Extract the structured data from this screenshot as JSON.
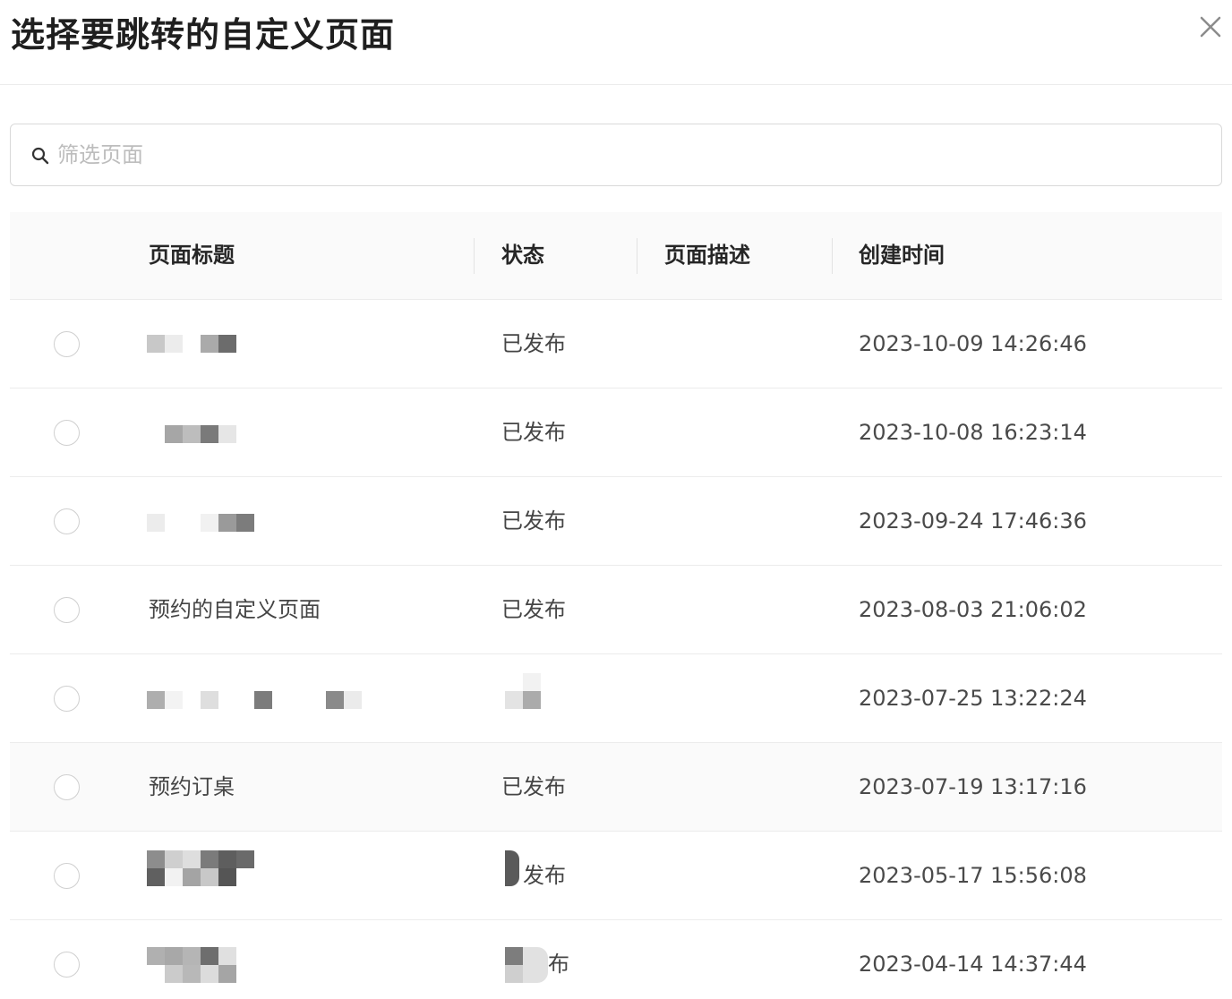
{
  "dialog": {
    "title": "选择要跳转的自定义页面"
  },
  "search": {
    "placeholder": "筛选页面",
    "value": ""
  },
  "table": {
    "columns": [
      "页面标题",
      "状态",
      "页面描述",
      "创建时间"
    ],
    "rows": [
      {
        "title": "",
        "status": "已发布",
        "description": "",
        "created": "2023-10-09 14:26:46"
      },
      {
        "title": "",
        "status": "已发布",
        "description": "",
        "created": "2023-10-08 16:23:14"
      },
      {
        "title": "",
        "status": "已发布",
        "description": "",
        "created": "2023-09-24 17:46:36"
      },
      {
        "title": "预约的自定义页面",
        "status": "已发布",
        "description": "",
        "created": "2023-08-03 21:06:02"
      },
      {
        "title": "",
        "status": "",
        "description": "",
        "created": "2023-07-25 13:22:24"
      },
      {
        "title": "预约订桌",
        "status": "已发布",
        "description": "",
        "created": "2023-07-19 13:17:16"
      },
      {
        "title": "",
        "status": "发布",
        "description": "",
        "created": "2023-05-17 15:56:08"
      },
      {
        "title": "",
        "status": "布",
        "description": "",
        "created": "2023-04-14 14:37:44"
      }
    ]
  },
  "colors": {
    "border": "#ececec",
    "header_bg": "#fafafa",
    "hover_row_bg": "#fafafa",
    "title_text": "#1f1f1f",
    "body_text": "#454545",
    "placeholder": "#bdbdbd"
  },
  "icons": {
    "close": "close-icon",
    "search": "search-icon"
  }
}
